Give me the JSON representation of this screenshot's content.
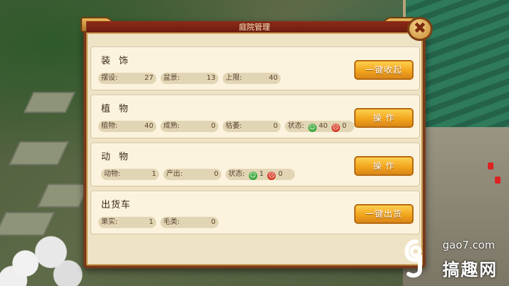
{
  "dialog": {
    "title": "庭院管理",
    "close_glyph": "✖"
  },
  "panels": [
    {
      "title": "装 饰",
      "button": "一键收起",
      "stats": [
        {
          "key": "摆设:",
          "value": "27"
        },
        {
          "key": "盆景:",
          "value": "13"
        },
        {
          "key": "上限:",
          "value": "40"
        }
      ]
    },
    {
      "title": "植 物",
      "button": "操 作",
      "stats": [
        {
          "key": "植物:",
          "value": "40"
        },
        {
          "key": "成熟:",
          "value": "0"
        },
        {
          "key": "枯萎:",
          "value": "0"
        }
      ],
      "status": {
        "label": "状态:",
        "happy": "40",
        "sad": "0"
      }
    },
    {
      "title": "动 物",
      "button": "操 作",
      "stats": [
        {
          "key": "动物:",
          "value": "1"
        },
        {
          "key": "产出:",
          "value": "0"
        }
      ],
      "status": {
        "label": "状态:",
        "happy": "1",
        "sad": "0"
      }
    },
    {
      "title": "出货车",
      "button": "一键出货",
      "stats": [
        {
          "key": "果实:",
          "value": "1"
        },
        {
          "key": "毛类:",
          "value": "0"
        }
      ]
    }
  ],
  "watermark": {
    "url": "gao7.com",
    "name": "搞趣网"
  },
  "colors": {
    "title_bar": "#8d2a17",
    "panel_bg": "#fbf3de",
    "button": "#f0a21a",
    "happy": "#3ea83e",
    "sad": "#d8402c"
  }
}
